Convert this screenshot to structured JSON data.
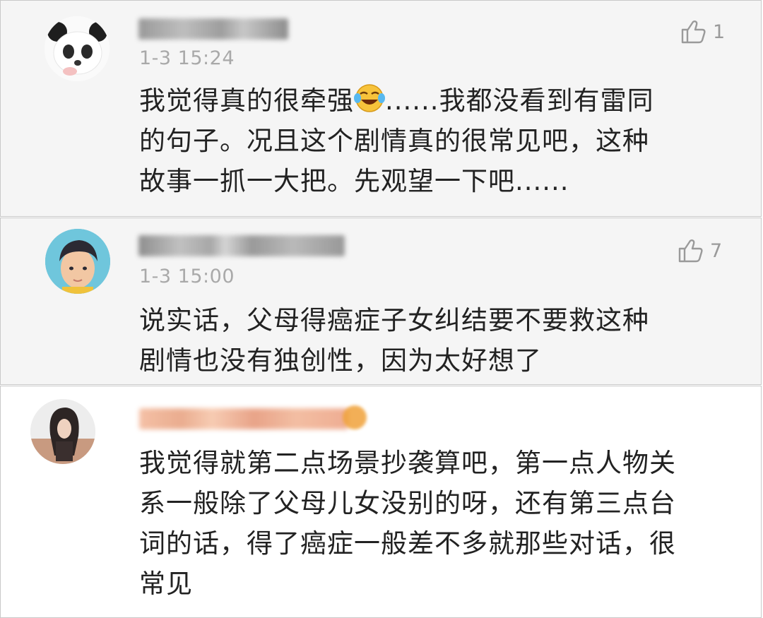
{
  "comments": [
    {
      "time": "1-3 15:24",
      "likes": "1",
      "text_before_emoji": "我觉得真的很牵强",
      "emoji": "laughing-crying-emoji",
      "text_after_emoji": "......我都没看到有雷同",
      "lines": [
        "的句子。况且这个剧情真的很常见吧，这种",
        "故事一抓一大把。先观望一下吧......"
      ]
    },
    {
      "time": "1-3 15:00",
      "likes": "7",
      "lines": [
        "说实话，父母得癌症子女纠结要不要救这种",
        "剧情也没有独创性，因为太好想了"
      ]
    },
    {
      "lines": [
        "我觉得就第二点场景抄袭算吧，第一点人物关",
        "系一般除了父母儿女没别的呀，还有第三点台",
        "词的话，得了癌症一般差不多就那些对话，很",
        "常见"
      ]
    }
  ],
  "colors": {
    "card_bg": "#f5f5f5",
    "border": "#c9c9c9",
    "timestamp": "#a9a9a9",
    "like_icon": "#9a9a9a",
    "username_blur_c3": "#f0b48e"
  }
}
